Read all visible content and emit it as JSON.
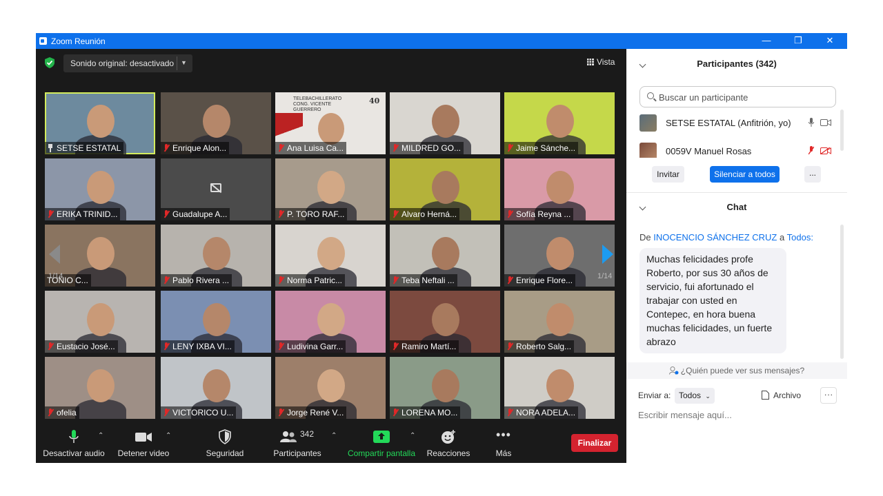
{
  "window": {
    "title": "Zoom Reunión",
    "controls": [
      "—",
      "❐",
      "✕"
    ]
  },
  "meeting": {
    "sound_label": "Sonido original: desactivado",
    "view_label": "Vista",
    "page_left": "1/14",
    "page_right": "1/14",
    "tiles": [
      {
        "name": "SETSE ESTATAL",
        "icon": "pin",
        "active": true,
        "bg": "#6d8a9e"
      },
      {
        "name": "Enrique Alon...",
        "icon": "muted",
        "bg": "#5a5148"
      },
      {
        "name": "Ana Luisa Ca...",
        "icon": "muted",
        "bg": "#e9e6e2",
        "overlay": "TELEBACHILLERATO CONG. VICENTE GUERRERO",
        "badge": "40"
      },
      {
        "name": "MILDRED GO...",
        "icon": "muted",
        "bg": "#d9d6d0"
      },
      {
        "name": "Jaime Sánche...",
        "icon": "muted",
        "bg": "#c5d84a"
      },
      {
        "name": "ERIKA TRINID...",
        "icon": "muted",
        "bg": "#8c96a8"
      },
      {
        "name": "Guadalupe A...",
        "icon": "muted",
        "bg": "#4b4b4b",
        "camoff": true
      },
      {
        "name": "P. TORO RAF...",
        "icon": "muted",
        "bg": "#a79b8c"
      },
      {
        "name": "Alvaro Herná...",
        "icon": "muted",
        "bg": "#b4b23a"
      },
      {
        "name": "Sofía Reyna ...",
        "icon": "muted",
        "bg": "#d99aa7"
      },
      {
        "name": "TONIO C...",
        "icon": "none",
        "bg": "#8a7460"
      },
      {
        "name": "Pablo Rivera ...",
        "icon": "muted",
        "bg": "#b7b3ad"
      },
      {
        "name": "Norma Patric...",
        "icon": "muted",
        "bg": "#d8d4cf"
      },
      {
        "name": "Teba Neftali ...",
        "icon": "muted",
        "bg": "#c2c0b8"
      },
      {
        "name": "Enrique Flore...",
        "icon": "muted",
        "bg": "#6e6e6e"
      },
      {
        "name": "Eustacio José...",
        "icon": "muted",
        "bg": "#b8b4b0"
      },
      {
        "name": "LENY IXBA VI...",
        "icon": "muted",
        "bg": "#7b8fb2"
      },
      {
        "name": "Ludivina Garr...",
        "icon": "muted",
        "bg": "#c88aa6"
      },
      {
        "name": "Ramiro Martí...",
        "icon": "muted",
        "bg": "#7c4a3f"
      },
      {
        "name": "Roberto Salg...",
        "icon": "muted",
        "bg": "#a89c86"
      },
      {
        "name": "ofelia",
        "icon": "muted",
        "bg": "#9e8f86"
      },
      {
        "name": "VICTORICO U...",
        "icon": "muted",
        "bg": "#c0c4c8"
      },
      {
        "name": "Jorge René V...",
        "icon": "muted",
        "bg": "#9d7f6a"
      },
      {
        "name": "LORENA MO...",
        "icon": "muted",
        "bg": "#8a9b88"
      },
      {
        "name": "NORA ADELA...",
        "icon": "muted",
        "bg": "#cfccc6"
      }
    ]
  },
  "toolbar": {
    "audio": "Desactivar audio",
    "video": "Detener video",
    "security": "Seguridad",
    "participants": "Participantes",
    "participants_count": "342",
    "share": "Compartir pantalla",
    "reactions": "Reacciones",
    "more": "Más",
    "end": "Finalizar"
  },
  "participants_panel": {
    "title": "Participantes (342)",
    "search_placeholder": "Buscar un participante",
    "rows": [
      {
        "name": "SETSE ESTATAL (Anfitrión, yo)"
      },
      {
        "name": "0059V Manuel Rosas"
      }
    ],
    "invite": "Invitar",
    "mute_all": "Silenciar a todos",
    "more": "..."
  },
  "chat": {
    "title": "Chat",
    "from_prefix": "De",
    "from_name": "INOCENCIO SÁNCHEZ CRUZ",
    "to_word": "a",
    "to_target": "Todos:",
    "message": "Muchas felicidades profe Roberto, por sus 30 años de servicio, fui afortunado el trabajar con usted en Contepec, en hora buena muchas felicidades, un fuerte abrazo",
    "who_sees": "¿Quién puede ver sus mensajes?",
    "send_to_label": "Enviar a:",
    "send_to_value": "Todos",
    "file_label": "Archivo",
    "input_placeholder": "Escribir mensaje aquí..."
  },
  "colors": {
    "titlebar": "#0e71eb",
    "end_button": "#d4232f",
    "share_green": "#23d959",
    "active_speaker": "#d4ec5d",
    "link_blue": "#0e71eb"
  }
}
